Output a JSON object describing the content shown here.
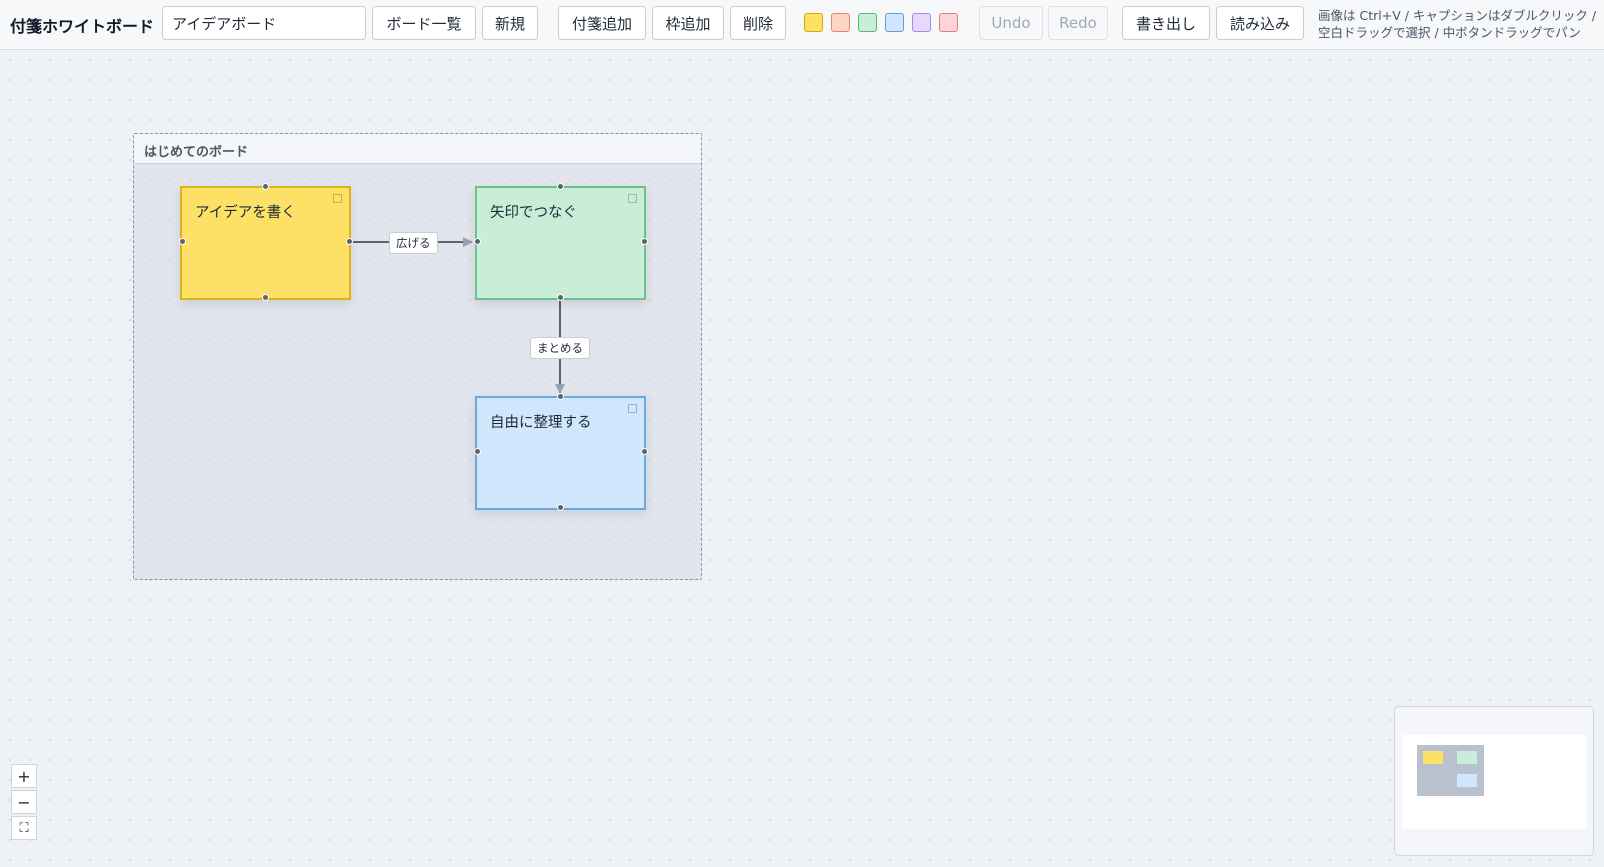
{
  "app": {
    "title": "付箋ホワイトボード"
  },
  "toolbar": {
    "board_name": "アイデアボード",
    "board_list_label": "ボード一覧",
    "new_label": "新規",
    "add_note_label": "付箋追加",
    "add_frame_label": "枠追加",
    "delete_label": "削除",
    "undo_label": "Undo",
    "redo_label": "Redo",
    "export_label": "書き出し",
    "import_label": "読み込み",
    "swatches": [
      {
        "name": "yellow",
        "fill": "#fde166",
        "border": "#d9a800"
      },
      {
        "name": "orange",
        "fill": "#fed7c4",
        "border": "#e8876a"
      },
      {
        "name": "green",
        "fill": "#c8eed8",
        "border": "#58b87b"
      },
      {
        "name": "blue",
        "fill": "#cfe6fc",
        "border": "#5a9fdc"
      },
      {
        "name": "purple",
        "fill": "#e6d9fd",
        "border": "#a98ae6"
      },
      {
        "name": "pink",
        "fill": "#fdd4d9",
        "border": "#e27b89"
      }
    ],
    "help_line1": "画像は Ctrl+V / キャプションはダブルクリック /",
    "help_line2": "空白ドラッグで選択 / 中ボタンドラッグでパン"
  },
  "frame": {
    "title": "はじめてのボード",
    "border_color": "#8c93a0"
  },
  "notes": [
    {
      "id": "n1",
      "text": "アイデアを書く",
      "fill": "#fde166",
      "border": "#e0b21a"
    },
    {
      "id": "n2",
      "text": "矢印でつなぐ",
      "fill": "#c8eed8",
      "border": "#6cc28d"
    },
    {
      "id": "n3",
      "text": "自由に整理する",
      "fill": "#cfe6fc",
      "border": "#6aa8e0"
    }
  ],
  "edges": [
    {
      "from": "n1",
      "to": "n2",
      "label": "広げる"
    },
    {
      "from": "n2",
      "to": "n3",
      "label": "まとめる"
    }
  ],
  "zoom": {
    "in_label": "+",
    "out_label": "−",
    "fit_label": "⛶"
  },
  "icons": {
    "note_menu": "note-menu-icon",
    "fit": "fit-view-icon"
  }
}
